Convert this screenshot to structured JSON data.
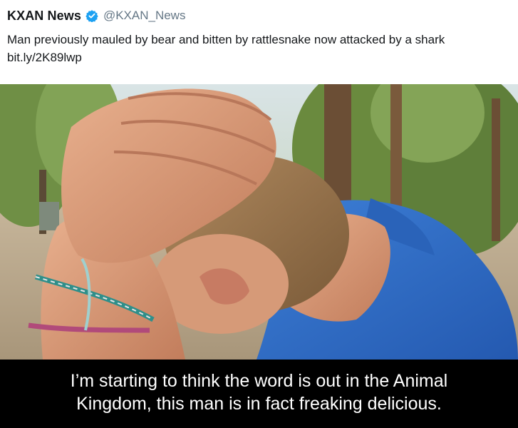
{
  "tweet": {
    "account_name": "KXAN News",
    "handle": "@KXAN_News",
    "verified_icon": "verified-check-icon",
    "text_main": "Man previously mauled by bear and bitten by rattlesnake now attacked by a shark",
    "link": "bit.ly/2K89lwp",
    "colors": {
      "badge": "#1da1f2",
      "name": "#14171a",
      "handle": "#657786"
    }
  },
  "photo": {
    "subject": "man-holding-head-photo"
  },
  "caption": {
    "line1": "I’m starting to think the word is out in the Animal",
    "line2": "Kingdom, this man is in fact freaking delicious."
  }
}
